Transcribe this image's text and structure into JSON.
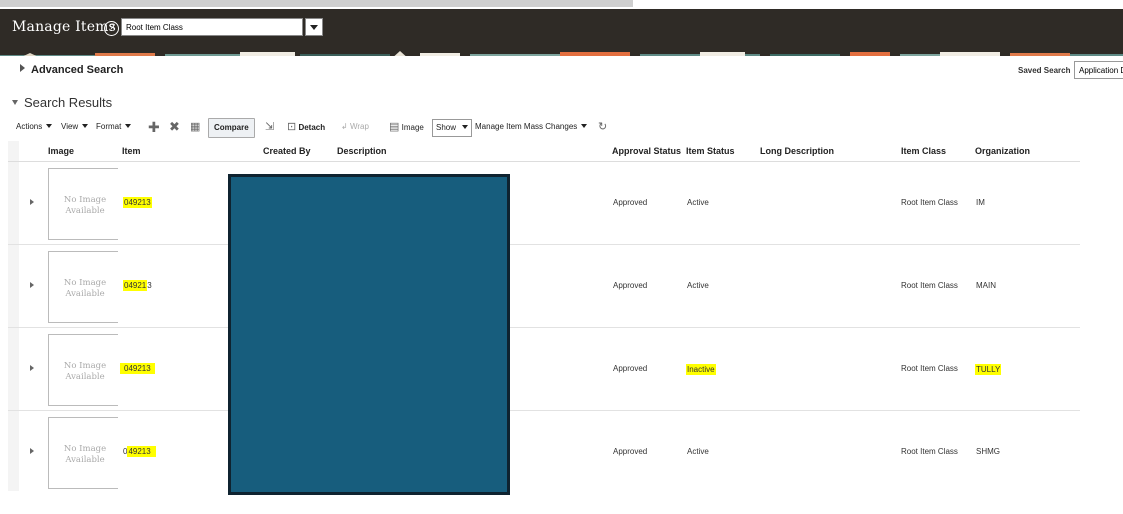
{
  "header": {
    "title": "Manage Items",
    "item_class": "Root Item Class"
  },
  "search": {
    "advanced_label": "Advanced Search",
    "saved_search_label": "Saved Search",
    "saved_search_value": "Application D"
  },
  "results": {
    "title": "Search Results"
  },
  "toolbar": {
    "actions": "Actions",
    "view": "View",
    "format": "Format",
    "compare": "Compare",
    "detach": "Detach",
    "wrap": "Wrap",
    "image": "Image",
    "show": "Show",
    "mass_changes": "Manage Item Mass Changes"
  },
  "columns": {
    "image": "Image",
    "item": "Item",
    "created_by": "Created By",
    "description": "Description",
    "approval_status": "Approval Status",
    "item_status": "Item Status",
    "long_description": "Long Description",
    "item_class": "Item Class",
    "organization": "Organization"
  },
  "no_image": {
    "line1": "No Image",
    "line2": "Available"
  },
  "rows": [
    {
      "item_pre": "",
      "item_hl": "049213",
      "item_post": "",
      "approval": "Approved",
      "status": "Active",
      "status_hl": false,
      "item_class": "Root Item Class",
      "org": "IM",
      "org_hl": false
    },
    {
      "item_pre": "",
      "item_hl": "04921",
      "item_post": "3",
      "approval": "Approved",
      "status": "Active",
      "status_hl": false,
      "item_class": "Root Item Class",
      "org": "MAIN",
      "org_hl": false
    },
    {
      "item_pre": "",
      "item_hl": "049213",
      "item_post": "",
      "approval": "Approved",
      "status": "Inactive",
      "status_hl": true,
      "item_class": "Root Item Class",
      "org": "TULLY",
      "org_hl": true
    },
    {
      "item_pre": "0",
      "item_hl": "49213",
      "item_post": "",
      "approval": "Approved",
      "status": "Active",
      "status_hl": false,
      "item_class": "Root Item Class",
      "org": "SHMG",
      "org_hl": false
    }
  ],
  "colors": {
    "header_bg": "#2f2b26",
    "highlight": "#ffff00",
    "redaction": "#175d7d"
  }
}
